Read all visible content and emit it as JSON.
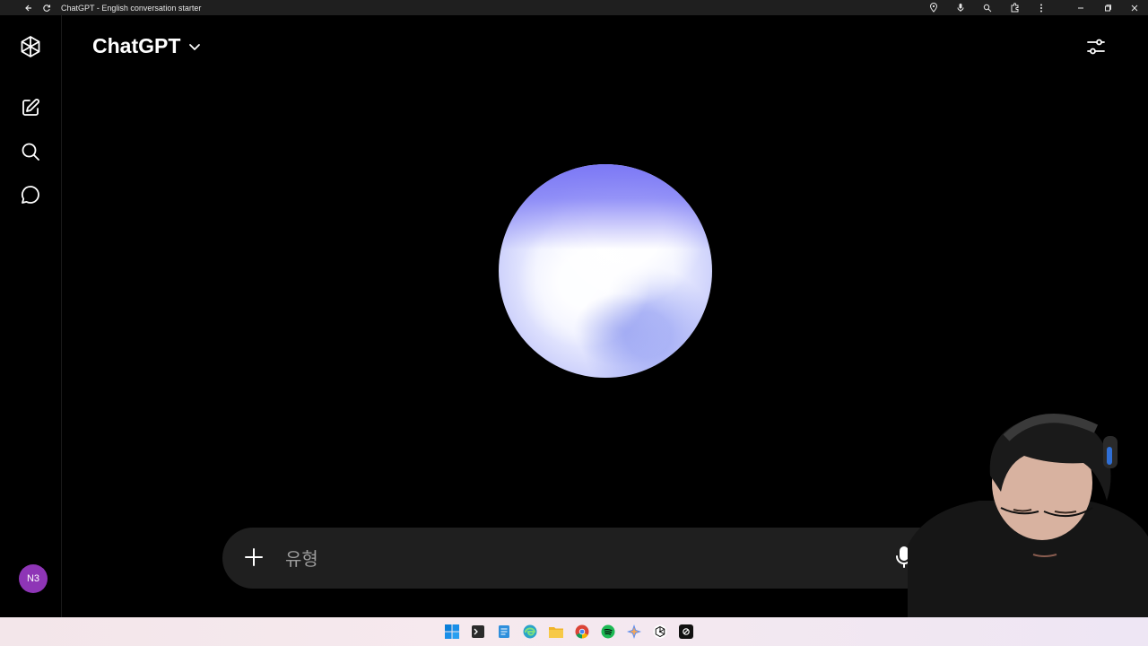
{
  "browser": {
    "tab_title": "ChatGPT - English conversation starter"
  },
  "header": {
    "model_label": "ChatGPT"
  },
  "sidebar": {
    "items": [
      {
        "icon": "openai-logo-icon"
      },
      {
        "icon": "new-chat-icon"
      },
      {
        "icon": "search-icon"
      },
      {
        "icon": "chat-bubble-icon"
      }
    ],
    "avatar_initials": "N3"
  },
  "composer": {
    "placeholder": "유형",
    "value": ""
  },
  "colors": {
    "avatar": "#8e35b6",
    "composer_bg": "#1f1f1f",
    "orb_top": "#7f7cf5",
    "orb_body": "#eef0ff"
  },
  "taskbar": {
    "apps": [
      "windows-start-icon",
      "terminal-icon",
      "notepad-icon",
      "edge-icon",
      "file-explorer-icon",
      "chrome-icon",
      "spotify-icon",
      "copilot-icon",
      "chatgpt-icon",
      "cursor-icon"
    ]
  }
}
